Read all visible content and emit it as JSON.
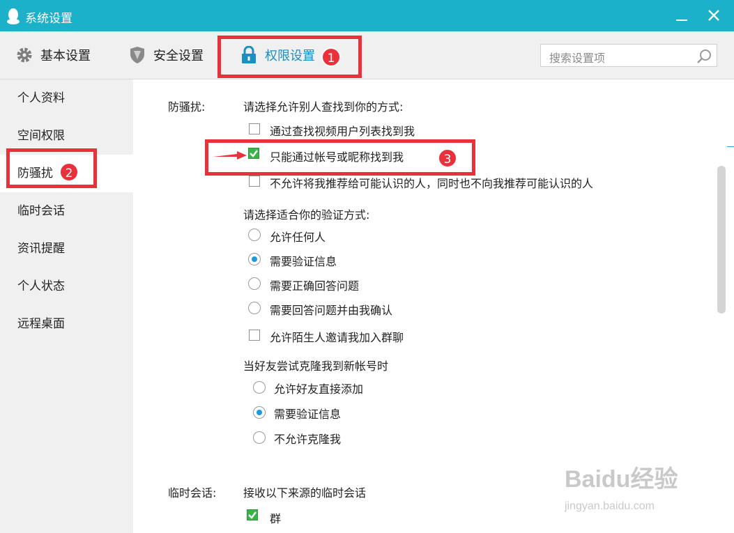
{
  "window": {
    "title": "系统设置"
  },
  "tabs": [
    {
      "label": "基本设置",
      "icon": "gear-icon"
    },
    {
      "label": "安全设置",
      "icon": "shield-icon"
    },
    {
      "label": "权限设置",
      "icon": "lock-icon",
      "active": true
    }
  ],
  "search": {
    "placeholder": "搜索设置项"
  },
  "sidebar": {
    "items": [
      {
        "label": "个人资料"
      },
      {
        "label": "空间权限"
      },
      {
        "label": "防骚扰",
        "active": true
      },
      {
        "label": "临时会话"
      },
      {
        "label": "资讯提醒"
      },
      {
        "label": "个人状态"
      },
      {
        "label": "远程桌面"
      }
    ]
  },
  "harass": {
    "section_label": "防骚扰:",
    "find_prompt": "请选择允许别人查找到你的方式:",
    "find_options": [
      {
        "label": "通过查找视频用户列表找到我",
        "checked": false
      },
      {
        "label": "只能通过帐号或昵称找到我",
        "checked": true
      },
      {
        "label": "不允许将我推荐给可能认识的人，同时也不向我推荐可能认识的人",
        "checked": false
      }
    ],
    "verify_prompt": "请选择适合你的验证方式:",
    "verify_options": [
      {
        "label": "允许任何人",
        "selected": false
      },
      {
        "label": "需要验证信息",
        "selected": true
      },
      {
        "label": "需要正确回答问题",
        "selected": false
      },
      {
        "label": "需要回答问题并由我确认",
        "selected": false
      }
    ],
    "group_invite": {
      "label": "允许陌生人邀请我加入群聊",
      "checked": false
    },
    "clone_prompt": "当好友尝试克隆我到新帐号时",
    "clone_options": [
      {
        "label": "允许好友直接添加",
        "selected": false
      },
      {
        "label": "需要验证信息",
        "selected": true
      },
      {
        "label": "不允许克隆我",
        "selected": false
      }
    ]
  },
  "temp_chat": {
    "section_label": "临时会话:",
    "prompt": "接收以下来源的临时会话",
    "options": [
      {
        "label": "群",
        "checked": true
      }
    ]
  },
  "annotations": {
    "badge1": "1",
    "badge2": "2",
    "badge3": "3",
    "highlight_color": "#e8313a"
  },
  "watermark": {
    "logo": "Baidu经验",
    "url": "jingyan.baidu.com"
  },
  "colors": {
    "titlebar": "#1bb2c9",
    "active_tab": "#1a8fc2",
    "checkbox_checked": "#3ab44a",
    "radio_dot": "#1a9be0"
  }
}
